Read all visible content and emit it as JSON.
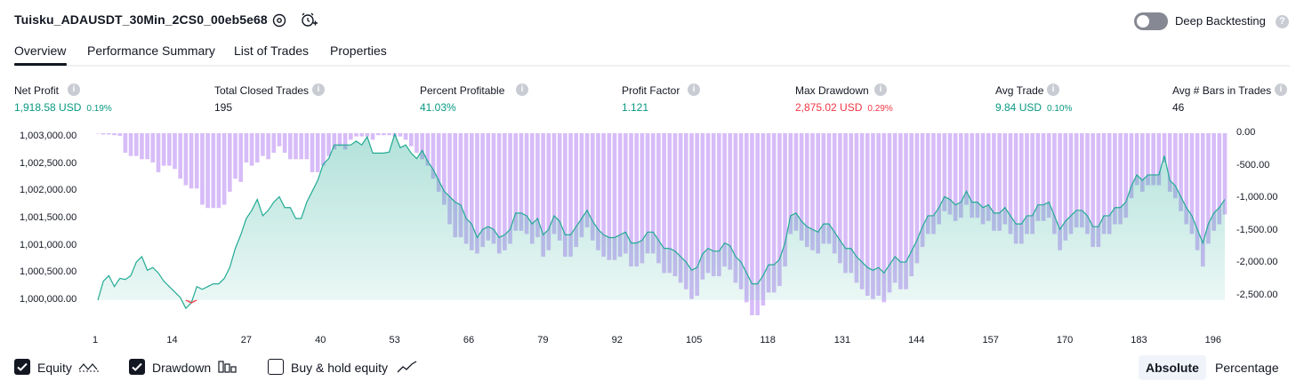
{
  "header": {
    "title": "Tuisku_ADAUSDT_30Min_2CS0_00eb5e68",
    "deep_backtesting_label": "Deep Backtesting",
    "deep_backtesting_on": false
  },
  "tabs": [
    {
      "label": "Overview",
      "active": true
    },
    {
      "label": "Performance Summary",
      "active": false
    },
    {
      "label": "List of Trades",
      "active": false
    },
    {
      "label": "Properties",
      "active": false
    }
  ],
  "metrics": [
    {
      "label": "Net Profit",
      "value": "1,918.58 USD",
      "pct": "0.19%",
      "color": "#089981"
    },
    {
      "label": "Total Closed Trades",
      "value": "195",
      "pct": "",
      "color": "#131722"
    },
    {
      "label": "Percent Profitable",
      "value": "41.03%",
      "pct": "",
      "color": "#089981"
    },
    {
      "label": "Profit Factor",
      "value": "1.121",
      "pct": "",
      "color": "#089981"
    },
    {
      "label": "Max Drawdown",
      "value": "2,875.02 USD",
      "pct": "0.29%",
      "color": "#f23645"
    },
    {
      "label": "Avg Trade",
      "value": "9.84 USD",
      "pct": "0.10%",
      "color": "#089981"
    },
    {
      "label": "Avg # Bars in Trades",
      "value": "46",
      "pct": "",
      "color": "#131722"
    }
  ],
  "chart_data": {
    "type": "line",
    "left_axis_ticks": [
      "1,003,000.00",
      "1,002,500.00",
      "1,002,000.00",
      "1,001,500.00",
      "1,001,000.00",
      "1,000,500.00",
      "1,000,000.00"
    ],
    "right_axis_ticks": [
      "0.00",
      "-500.00",
      "-1,000.00",
      "-1,500.00",
      "-2,000.00",
      "-2,500.00"
    ],
    "x_ticks": [
      "1",
      "14",
      "27",
      "40",
      "53",
      "66",
      "79",
      "92",
      "105",
      "118",
      "131",
      "144",
      "157",
      "170",
      "183",
      "196"
    ],
    "left_ylim": [
      1000000,
      1003000
    ],
    "right_ylim": [
      -2500,
      0
    ],
    "series": [
      {
        "name": "Equity",
        "color": "#22ab94",
        "values": [
          1000000,
          1000350,
          1000450,
          1000250,
          1000400,
          1000380,
          1000450,
          1000700,
          1000800,
          1000550,
          1000600,
          1000500,
          1000350,
          1000250,
          1000150,
          1000050,
          999850,
          999950,
          1000250,
          1000200,
          1000250,
          1000300,
          1000300,
          1000400,
          1000600,
          1000950,
          1001200,
          1001500,
          1001650,
          1001850,
          1001550,
          1001650,
          1001800,
          1001900,
          1001700,
          1001700,
          1001500,
          1001500,
          1001800,
          1002000,
          1002200,
          1002500,
          1002600,
          1002850,
          1002850,
          1002850,
          1002850,
          1002920,
          1002850,
          1003000,
          1002700,
          1002700,
          1002700,
          1002720,
          1003050,
          1002800,
          1002850,
          1002700,
          1002600,
          1002750,
          1002550,
          1002400,
          1002200,
          1002000,
          1001900,
          1001800,
          1001750,
          1001500,
          1001400,
          1001150,
          1001300,
          1001350,
          1001300,
          1001150,
          1001200,
          1001300,
          1001600,
          1001600,
          1001550,
          1001400,
          1001500,
          1001200,
          1001300,
          1001550,
          1001450,
          1001200,
          1001200,
          1001350,
          1001500,
          1001650,
          1001450,
          1001300,
          1001200,
          1001150,
          1001150,
          1001200,
          1001250,
          1001050,
          1001050,
          1001100,
          1001250,
          1001250,
          1001100,
          1000950,
          1000950,
          1000900,
          1000800,
          1000700,
          1000550,
          1000600,
          1000850,
          1000950,
          1000900,
          1000900,
          1001050,
          1001000,
          1000800,
          1000700,
          1000500,
          1000300,
          1000300,
          1000450,
          1000650,
          1000650,
          1000750,
          1001050,
          1001550,
          1001600,
          1001450,
          1001350,
          1001300,
          1001250,
          1001400,
          1001400,
          1001250,
          1001100,
          1000950,
          1000950,
          1000800,
          1000700,
          1000600,
          1000550,
          1000600,
          1000500,
          1000650,
          1000800,
          1000700,
          1000700,
          1000900,
          1001100,
          1001350,
          1001550,
          1001550,
          1001700,
          1001900,
          1001850,
          1001750,
          1001800,
          1002000,
          1001800,
          1001800,
          1001700,
          1001750,
          1001600,
          1001600,
          1001700,
          1001550,
          1001400,
          1001400,
          1001550,
          1001550,
          1001750,
          1001750,
          1001800,
          1001550,
          1001300,
          1001450,
          1001550,
          1001650,
          1001650,
          1001550,
          1001350,
          1001350,
          1001550,
          1001550,
          1001700,
          1001700,
          1001800,
          1002100,
          1002300,
          1002200,
          1002300,
          1002300,
          1002300,
          1002650,
          1002200,
          1002100,
          1001900,
          1001700,
          1001550,
          1001300,
          1001050,
          1001400,
          1001600,
          1001700,
          1001850
        ]
      },
      {
        "name": "Drawdown",
        "color": "#c9a6f5",
        "values": [
          0,
          -20,
          -20,
          -30,
          -40,
          -300,
          -350,
          -350,
          -400,
          -400,
          -450,
          -600,
          -500,
          -500,
          -550,
          -700,
          -800,
          -850,
          -850,
          -1100,
          -1150,
          -1150,
          -1150,
          -1100,
          -900,
          -700,
          -750,
          -450,
          -500,
          -450,
          -350,
          -400,
          -300,
          -200,
          -300,
          -400,
          -400,
          -400,
          -400,
          -600,
          -600,
          -500,
          -350,
          -250,
          -200,
          -250,
          -100,
          -50,
          -50,
          -50,
          -100,
          -30,
          -30,
          -30,
          -50,
          -50,
          -100,
          -200,
          -300,
          -400,
          -500,
          -700,
          -900,
          -1100,
          -1400,
          -1600,
          -1600,
          -1700,
          -1800,
          -1850,
          -1750,
          -1650,
          -1700,
          -1850,
          -1800,
          -1700,
          -1500,
          -1500,
          -1550,
          -1700,
          -1600,
          -1900,
          -1800,
          -1550,
          -1650,
          -1900,
          -1900,
          -1750,
          -1600,
          -1450,
          -1650,
          -1800,
          -1900,
          -1950,
          -1950,
          -1900,
          -1850,
          -2050,
          -2050,
          -2000,
          -1850,
          -1850,
          -2000,
          -2150,
          -2150,
          -2200,
          -2300,
          -2400,
          -2550,
          -2500,
          -2250,
          -2150,
          -2200,
          -2200,
          -2050,
          -2100,
          -2300,
          -2400,
          -2600,
          -2800,
          -2800,
          -2650,
          -2450,
          -2450,
          -2350,
          -2050,
          -1550,
          -1500,
          -1650,
          -1750,
          -1800,
          -1850,
          -1700,
          -1700,
          -1850,
          -2000,
          -2150,
          -2150,
          -2300,
          -2400,
          -2500,
          -2550,
          -2500,
          -2600,
          -2450,
          -2300,
          -2400,
          -2400,
          -2200,
          -2000,
          -1750,
          -1550,
          -1550,
          -1400,
          -1200,
          -1250,
          -1350,
          -1300,
          -1100,
          -1300,
          -1300,
          -1400,
          -1350,
          -1500,
          -1500,
          -1400,
          -1550,
          -1700,
          -1700,
          -1550,
          -1550,
          -1350,
          -1350,
          -1300,
          -1550,
          -1800,
          -1650,
          -1550,
          -1450,
          -1450,
          -1550,
          -1750,
          -1750,
          -1550,
          -1550,
          -1400,
          -1400,
          -1300,
          -1000,
          -800,
          -900,
          -800,
          -800,
          -800,
          -450,
          -900,
          -1000,
          -1200,
          -1400,
          -1550,
          -1800,
          -2050,
          -1700,
          -1500,
          -1400,
          -1250
        ]
      }
    ]
  },
  "legend": [
    {
      "label": "Equity",
      "checked": true,
      "icon": "equity-line-icon"
    },
    {
      "label": "Drawdown",
      "checked": true,
      "icon": "drawdown-bars-icon"
    },
    {
      "label": "Buy & hold equity",
      "checked": false,
      "icon": "buy-hold-line-icon"
    }
  ],
  "scale_toggle": [
    {
      "label": "Absolute",
      "active": true
    },
    {
      "label": "Percentage",
      "active": false
    }
  ]
}
